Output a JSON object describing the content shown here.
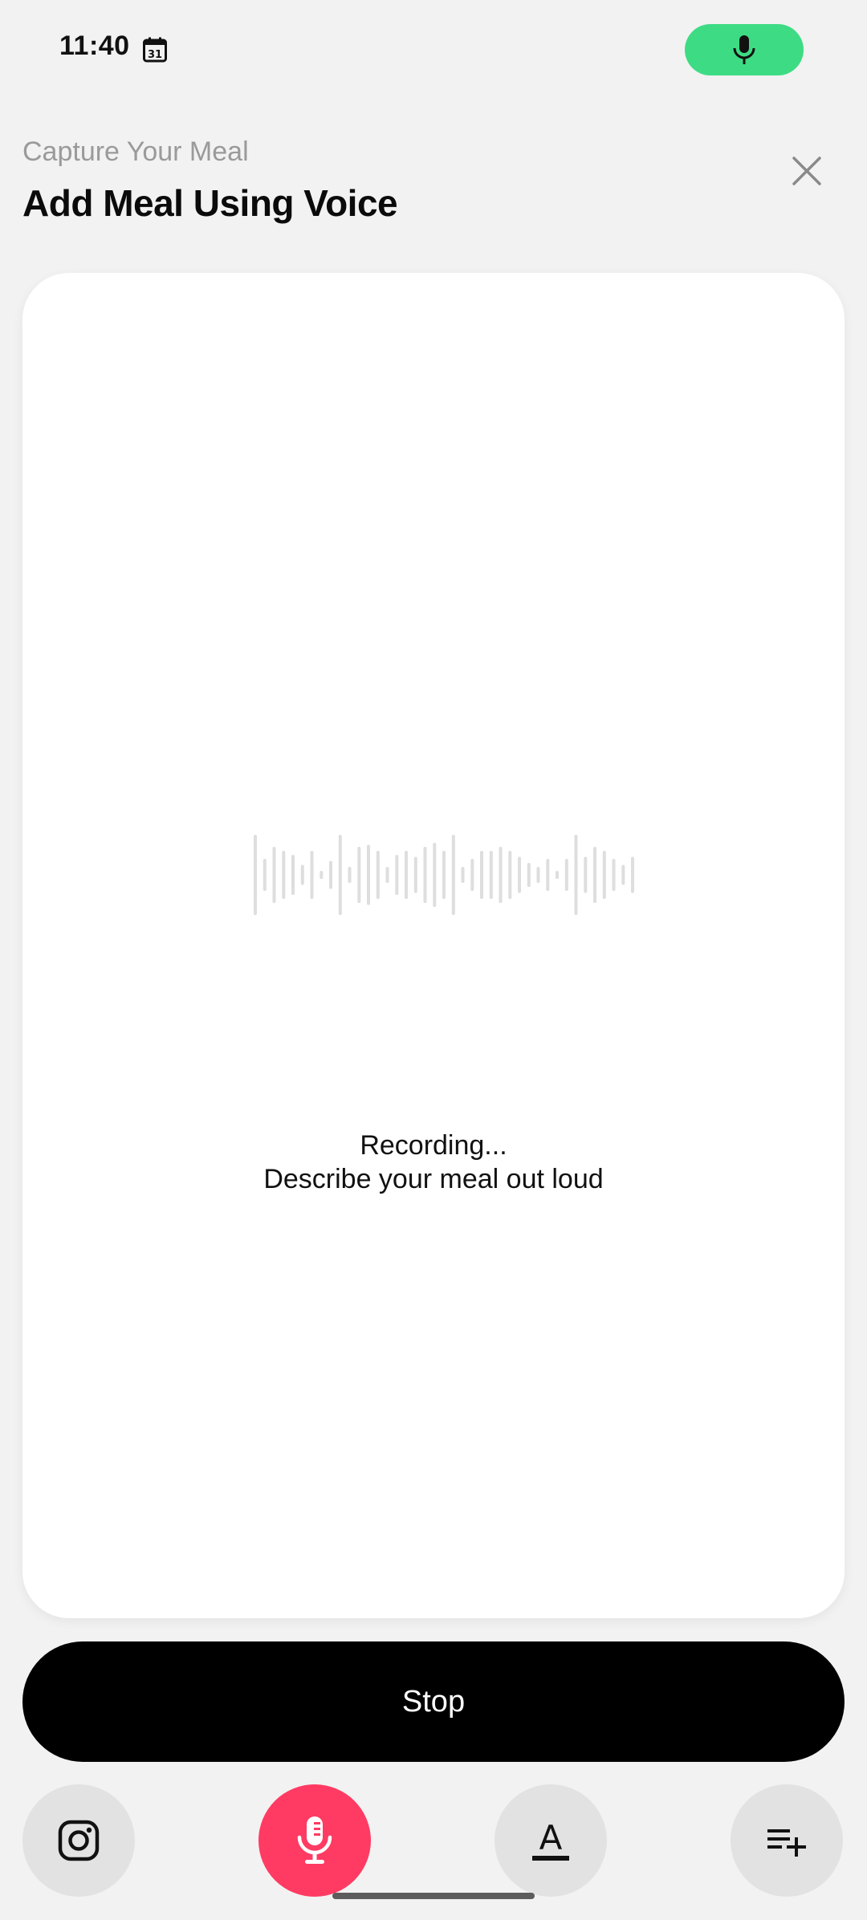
{
  "status_bar": {
    "time": "11:40",
    "calendar_day": "31",
    "mic_indicator_color": "#3ddc84",
    "calendar_icon": "calendar-icon",
    "mic_icon": "microphone-icon"
  },
  "header": {
    "subtitle": "Capture Your Meal",
    "title": "Add Meal Using Voice",
    "close_icon": "close-icon"
  },
  "recording": {
    "line1": "Recording...",
    "line2": "Describe your meal out loud",
    "waveform_icon": "waveform-icon"
  },
  "actions": {
    "stop_label": "Stop"
  },
  "bottom_bar": {
    "buttons": [
      {
        "icon": "instagram-icon"
      },
      {
        "icon": "microphone-icon",
        "active_color": "#ff3b63"
      },
      {
        "icon": "text-format-icon",
        "glyph": "A"
      },
      {
        "icon": "add-to-list-icon"
      }
    ]
  }
}
